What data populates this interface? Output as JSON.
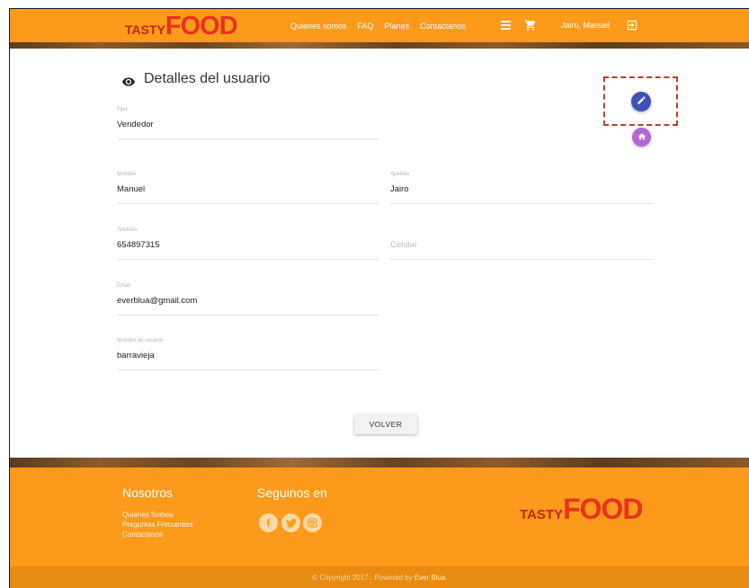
{
  "header": {
    "logo": {
      "part1": "TASTY",
      "part2": "FOOD"
    },
    "nav": [
      "Quienes somos",
      "FAQ",
      "Planes",
      "Contactanos"
    ],
    "user": "Jairo, Manuel"
  },
  "main": {
    "title": "Detalles del usuario",
    "fields": {
      "tipo": {
        "label": "Tipo",
        "value": "Vendedor"
      },
      "nombre": {
        "label": "Nombre",
        "value": "Manuel"
      },
      "apellido": {
        "label": "Apellido",
        "value": "Jairo"
      },
      "telefono": {
        "label": "Telefono",
        "value": "654897315"
      },
      "celular": {
        "placeholder": "Celular"
      },
      "email": {
        "label": "Email",
        "value": "everblua@gmail.com"
      },
      "usuario": {
        "label": "Nombre de usuario",
        "value": "barravieja"
      }
    },
    "back_button": "VOLVER"
  },
  "footer": {
    "nosotros_heading": "Nosotros",
    "links": [
      "Quienes Somos",
      "Preguntas Frecuentes",
      "Contactanos"
    ],
    "seguinos_heading": "Seguinos en",
    "social": {
      "facebook": "f",
      "twitter": "t",
      "instagram": "i"
    },
    "logo": {
      "part1": "TASTY",
      "part2": "FOOD"
    },
    "copyright": "© Copyright 2017 . Powered by",
    "powered_by": "Ever Blua."
  },
  "colors": {
    "primary_orange": "#fb9a1b",
    "edit_fab": "#3f51b5",
    "home_fab": "#b567d1",
    "highlight": "#c0392b"
  },
  "icons": [
    "eye-icon",
    "pencil-icon",
    "home-icon",
    "menu-icon",
    "cart-icon",
    "logout-icon",
    "facebook-icon",
    "twitter-icon",
    "instagram-icon"
  ]
}
